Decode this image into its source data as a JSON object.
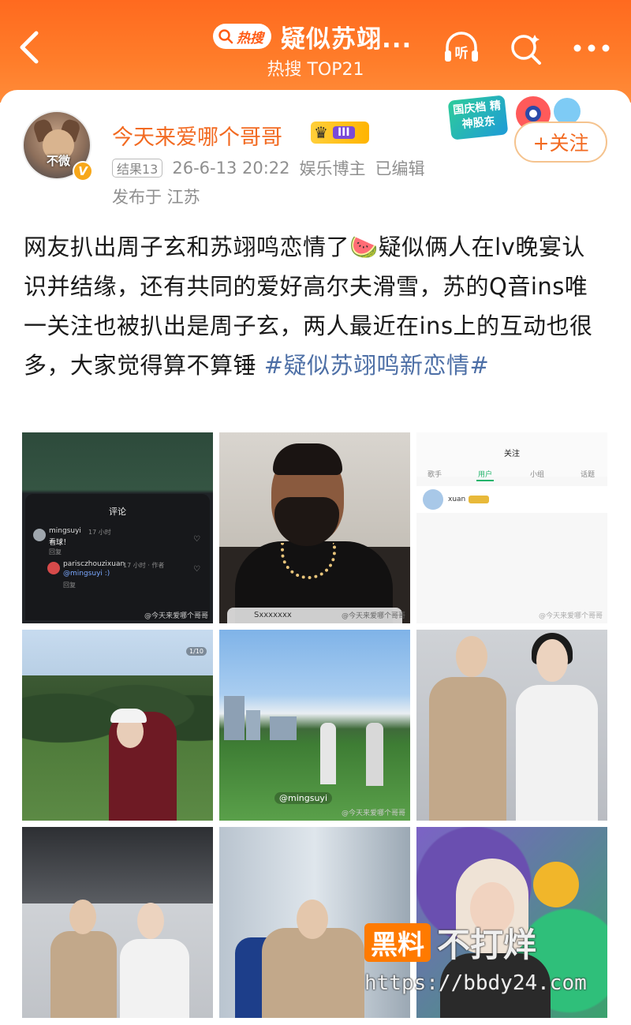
{
  "header": {
    "hot_label": "热搜",
    "title": "疑似苏翊...",
    "subtitle": "热搜 TOP21",
    "bg_color": "#ff6a1f",
    "icons": [
      "back-icon",
      "listen-icon",
      "search-icon",
      "more-icon"
    ],
    "listen_label": "听"
  },
  "post": {
    "username": "今天来爱哪个哥哥",
    "rank_label": "III",
    "avatar_caption": "不微",
    "tag": "结果13",
    "date": "26-6-13 20:22",
    "category": "娱乐博主",
    "edited": "已编辑",
    "location": "发布于 江苏",
    "follow_label": "+关注",
    "promo_text": "国庆档 精神股东",
    "text_main": "网友扒出周子玄和苏翊鸣恋情了🍉疑似俩人在lv晚宴认识并结缘，还有共同的爱好高尔夫滑雪，苏的Q音ins唯一关注也被扒出是周子玄，两人最近在ins上的互动也很多，大家觉得算不算锤 ",
    "hashtag": "#疑似苏翊鸣新恋情#"
  },
  "images": {
    "img1": {
      "panel_title": "评论",
      "c1_name": "mingsuyi",
      "c1_time": "17 小时",
      "c1_body": "看球！",
      "reply": "回复",
      "c2_name": "parisczhouzixuan",
      "c2_time": "17 小时 · 作者",
      "c2_body": "@mingsuyi :)",
      "watermark": "@今天来爱哪个哥哥"
    },
    "img2": {
      "bar_text": "Sxxxxxxx",
      "watermark": "@今天来爱哪个哥哥"
    },
    "img3": {
      "title": "关注",
      "tabs": [
        "歌手",
        "用户",
        "小组",
        "话题"
      ],
      "user": "xuan",
      "watermark": "@今天来爱哪个哥哥"
    },
    "img4": {
      "page": "1/10"
    },
    "img5": {
      "tag": "@mingsuyi",
      "watermark": "@今天来爱哪个哥哥"
    }
  },
  "watermark": {
    "box_text": "黑料",
    "rest_text": "不打烊",
    "url": "https://bbdy24.com"
  }
}
